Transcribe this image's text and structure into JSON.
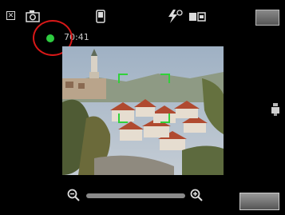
{
  "status": {
    "recording_time": "70:41"
  },
  "icons": {
    "close": "close-icon",
    "camera_mode": "camera-icon",
    "device": "phone-icon",
    "flash": "flash-icon",
    "video": "video-icon",
    "menu": "menu-button-icon",
    "zoom_out": "zoom-out-icon",
    "zoom_in": "zoom-in-icon",
    "side": "side-handle-icon",
    "options": "options-button-icon"
  },
  "zoom": {
    "level": 0.0
  },
  "colors": {
    "status_dot": "#2ecc40",
    "focus_frame": "#31d13a",
    "highlight_ring": "#d81818"
  }
}
